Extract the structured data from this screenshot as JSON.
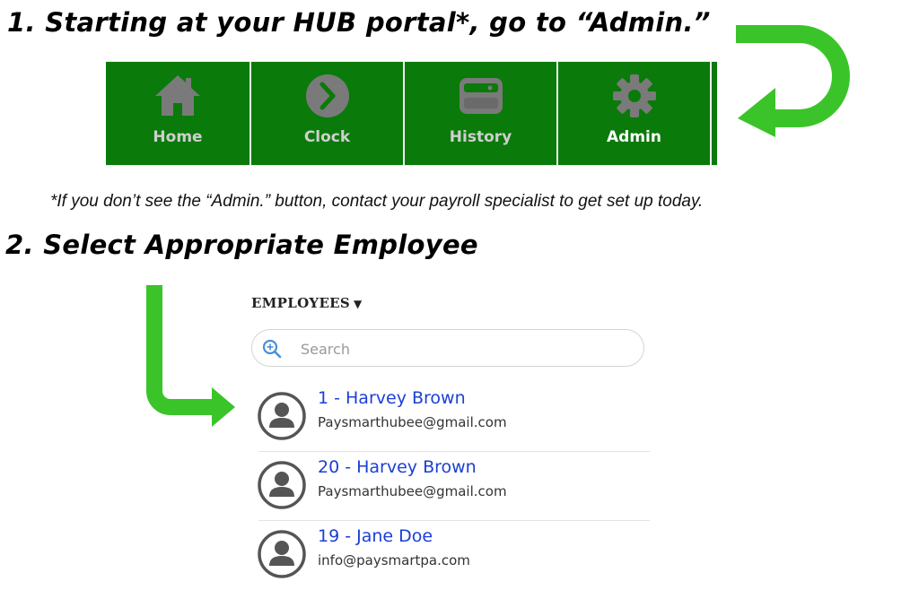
{
  "step1": {
    "heading": "1. Starting at your HUB portal*, go to “Admin.”"
  },
  "navbar": {
    "items": [
      {
        "label": "Home",
        "icon": "home-icon"
      },
      {
        "label": "Clock",
        "icon": "clock-icon"
      },
      {
        "label": "History",
        "icon": "history-icon"
      },
      {
        "label": "Admin",
        "icon": "gear-icon",
        "active": true
      }
    ],
    "colors": {
      "tile": "#0a7a0a",
      "label": "#cfcfcf",
      "active_label": "#ffffff",
      "icon": "#7a7a7a"
    }
  },
  "footnote": "*If you don’t see the “Admin.” button, contact your payroll specialist to get set up today.",
  "step2": {
    "heading": "2. Select Appropriate Employee"
  },
  "employees_panel": {
    "header": "EMPLOYEES",
    "header_caret": "▼",
    "search": {
      "placeholder": "Search",
      "value": ""
    },
    "items": [
      {
        "name": "1 - Harvey Brown",
        "email": "Paysmarthubee@gmail.com"
      },
      {
        "name": "20 - Harvey Brown",
        "email": "Paysmarthubee@gmail.com"
      },
      {
        "name": "19 - Jane Doe",
        "email": "info@paysmartpa.com"
      }
    ]
  },
  "colors": {
    "arrow": "#3ac42a",
    "link": "#1a3fd6"
  }
}
